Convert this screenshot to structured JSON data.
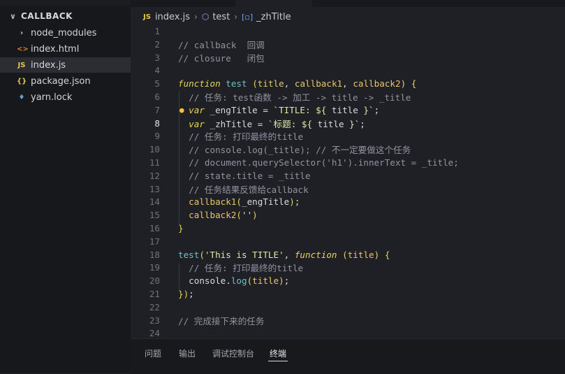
{
  "explorer": {
    "folder": "CALLBACK",
    "items": [
      {
        "label": "node_modules",
        "icon": "chevron-right-icon",
        "glyph": "›",
        "color": "#c9ccd4"
      },
      {
        "label": "index.html",
        "icon": "html-icon",
        "glyph": "<>",
        "color": "#e37933"
      },
      {
        "label": "index.js",
        "icon": "js-icon",
        "glyph": "JS",
        "color": "#e6c84c"
      },
      {
        "label": "package.json",
        "icon": "json-icon",
        "glyph": "{}",
        "color": "#e6c84c"
      },
      {
        "label": "yarn.lock",
        "icon": "yarn-icon",
        "glyph": "♦",
        "color": "#5aa0d8"
      }
    ]
  },
  "breadcrumb": {
    "file": "index.js",
    "symbol1": "test",
    "symbol2": "_zhTitle"
  },
  "lines": [
    {
      "n": "1",
      "seg": []
    },
    {
      "n": "2",
      "seg": [
        [
          "cm",
          "// callback  回调"
        ]
      ]
    },
    {
      "n": "3",
      "seg": [
        [
          "cm",
          "// closure   闭包"
        ]
      ]
    },
    {
      "n": "4",
      "seg": []
    },
    {
      "n": "5",
      "seg": [
        [
          "k",
          "function"
        ],
        [
          "pl",
          " "
        ],
        [
          "fn",
          "test"
        ],
        [
          "pl",
          " "
        ],
        [
          "br",
          "("
        ],
        [
          "par",
          "title"
        ],
        [
          "pl",
          ", "
        ],
        [
          "par",
          "callback1"
        ],
        [
          "pl",
          ", "
        ],
        [
          "par",
          "callback2"
        ],
        [
          "br",
          ")"
        ],
        [
          "pl",
          " "
        ],
        [
          "br",
          "{"
        ]
      ]
    },
    {
      "n": "6",
      "seg": [
        [
          "cm",
          "  // 任务: test函数 -> 加工 -> title -> _title"
        ]
      ]
    },
    {
      "n": "7",
      "seg": [
        [
          "k",
          "  var"
        ],
        [
          "pl",
          " _engTitle = "
        ],
        [
          "str",
          "`TITLE: ${ "
        ],
        [
          "pl",
          "title"
        ],
        [
          "str",
          " }`"
        ],
        [
          "pl",
          ";"
        ]
      ]
    },
    {
      "n": "8",
      "seg": [
        [
          "k",
          "  var"
        ],
        [
          "pl",
          " _zhTitle = "
        ],
        [
          "str",
          "`标题: ${ "
        ],
        [
          "pl",
          "title"
        ],
        [
          "str",
          " }`"
        ],
        [
          "pl",
          ";"
        ]
      ]
    },
    {
      "n": "9",
      "seg": [
        [
          "cm",
          "  // 任务: 打印最终的title"
        ]
      ]
    },
    {
      "n": "10",
      "seg": [
        [
          "cm",
          "  // console.log(_title); // 不一定要做这个任务"
        ]
      ]
    },
    {
      "n": "11",
      "seg": [
        [
          "cm",
          "  // document.querySelector('h1').innerText = _title;"
        ]
      ]
    },
    {
      "n": "12",
      "seg": [
        [
          "cm",
          "  // state.title = _title"
        ]
      ]
    },
    {
      "n": "13",
      "seg": [
        [
          "cm",
          "  // 任务结果反馈给callback"
        ]
      ]
    },
    {
      "n": "14",
      "seg": [
        [
          "par",
          "  callback1"
        ],
        [
          "br",
          "("
        ],
        [
          "pl",
          "_engTitle"
        ],
        [
          "br",
          ")"
        ],
        [
          "pl",
          ";"
        ]
      ]
    },
    {
      "n": "15",
      "seg": [
        [
          "par",
          "  callback2"
        ],
        [
          "br",
          "("
        ],
        [
          "str",
          "''"
        ],
        [
          "br",
          ")"
        ]
      ]
    },
    {
      "n": "16",
      "seg": [
        [
          "br",
          "}"
        ]
      ]
    },
    {
      "n": "17",
      "seg": []
    },
    {
      "n": "18",
      "seg": [
        [
          "fn",
          "test"
        ],
        [
          "br",
          "("
        ],
        [
          "str",
          "'This is TITLE'"
        ],
        [
          "pl",
          ", "
        ],
        [
          "k",
          "function"
        ],
        [
          "pl",
          " "
        ],
        [
          "br",
          "("
        ],
        [
          "par",
          "title"
        ],
        [
          "br",
          ")"
        ],
        [
          "pl",
          " "
        ],
        [
          "br",
          "{"
        ]
      ]
    },
    {
      "n": "19",
      "seg": [
        [
          "cm",
          "  // 任务: 打印最终的title"
        ]
      ]
    },
    {
      "n": "20",
      "seg": [
        [
          "pl",
          "  console."
        ],
        [
          "fn",
          "log"
        ],
        [
          "br",
          "("
        ],
        [
          "par",
          "title"
        ],
        [
          "br",
          ")"
        ],
        [
          "pl",
          ";"
        ]
      ]
    },
    {
      "n": "21",
      "seg": [
        [
          "br",
          "})"
        ],
        [
          "pl",
          ";"
        ]
      ]
    },
    {
      "n": "22",
      "seg": []
    },
    {
      "n": "23",
      "seg": [
        [
          "cm",
          "// 完成接下来的任务"
        ]
      ]
    },
    {
      "n": "24",
      "seg": []
    }
  ],
  "current_line": "8",
  "panel": {
    "tabs": [
      "问题",
      "输出",
      "调试控制台",
      "终端"
    ],
    "active": "终端"
  }
}
